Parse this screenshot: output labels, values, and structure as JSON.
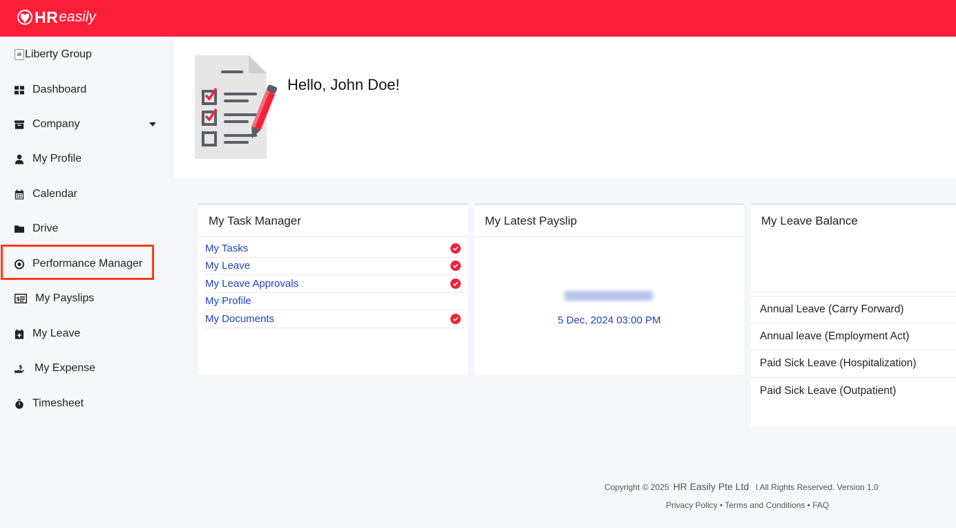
{
  "header": {
    "logo_bold": "HR",
    "logo_light": "easily",
    "brand_color": "#fb1e39"
  },
  "sidebar": {
    "company_image_alt": "Liberty Group",
    "items": [
      {
        "label": "Dashboard",
        "icon": "dashboard-icon"
      },
      {
        "label": "Company",
        "icon": "archive-icon",
        "has_dropdown": true
      },
      {
        "label": "My Profile",
        "icon": "user-icon"
      },
      {
        "label": "Calendar",
        "icon": "calendar-icon"
      },
      {
        "label": "Drive",
        "icon": "folder-icon"
      },
      {
        "label": "Performance Manager",
        "icon": "target-icon"
      },
      {
        "label": "My Payslips",
        "icon": "payslip-icon",
        "highlighted": true
      },
      {
        "label": "My Leave",
        "icon": "calendar-plus-icon"
      },
      {
        "label": "My Expense",
        "icon": "expense-hand-icon"
      },
      {
        "label": "Timesheet",
        "icon": "stopwatch-icon"
      }
    ]
  },
  "welcome": {
    "greeting": "Hello, John Doe!"
  },
  "task_manager": {
    "title": "My Task Manager",
    "items": [
      {
        "label": "My Tasks",
        "checked": true
      },
      {
        "label": "My Leave",
        "checked": true
      },
      {
        "label": "My Leave Approvals",
        "checked": true
      },
      {
        "label": "My Profile",
        "checked": false
      },
      {
        "label": "My Documents",
        "checked": true
      }
    ]
  },
  "payslip": {
    "title": "My Latest Payslip",
    "date": "5 Dec, 2024 03:00 PM"
  },
  "leave_balance": {
    "title": "My Leave Balance",
    "items": [
      "Annual Leave (Carry Forward)",
      "Annual leave (Employment Act)",
      "Paid Sick Leave (Hospitalization)",
      "Paid Sick Leave (Outpatient)"
    ]
  },
  "footer": {
    "copyright": "Copyright © 2025",
    "company": "HR Easily Pte Ltd",
    "rights": "l All Rights Reserved. Version 1.0",
    "links": "Privacy Policy • Terms and Conditions • FAQ"
  }
}
